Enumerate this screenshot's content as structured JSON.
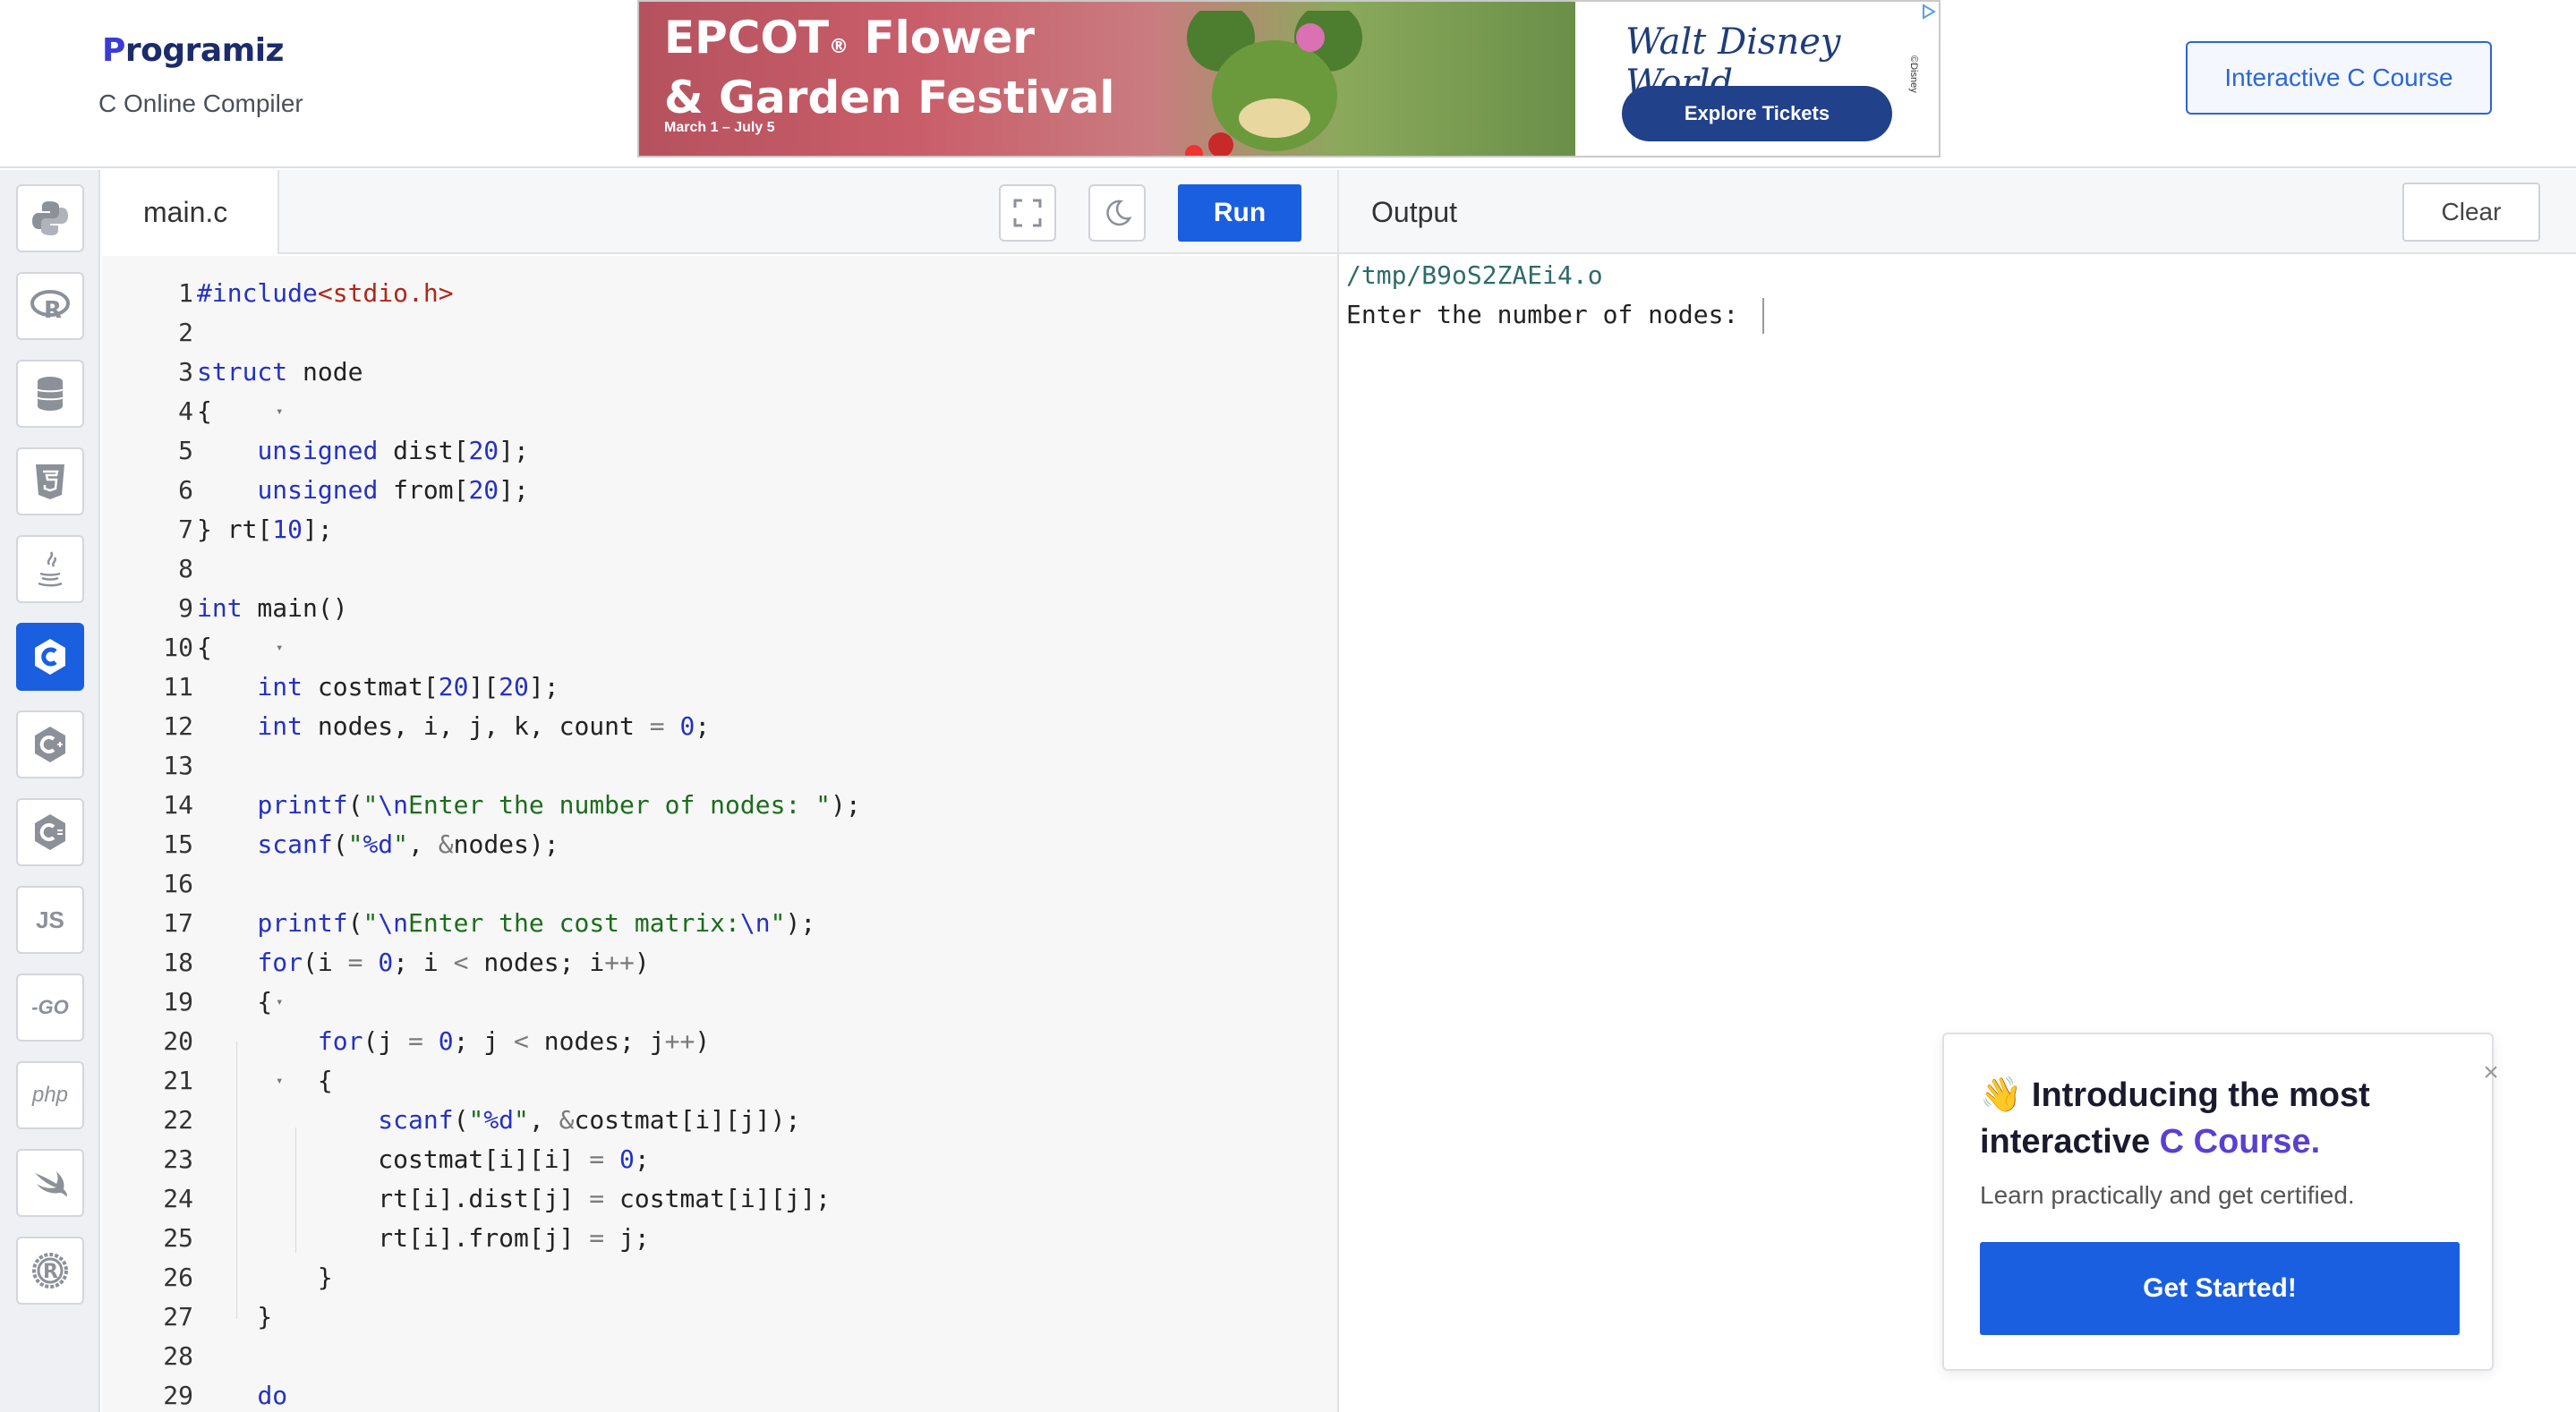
{
  "header": {
    "logo_text": "rogramiz",
    "logo_p": "P",
    "subtitle": "C Online Compiler",
    "course_button": "Interactive C Course"
  },
  "ad": {
    "title_line1": "EPCOT",
    "title_reg": "®",
    "title_line1b": " Flower",
    "title_line2": "& Garden Festival",
    "dates": "March 1 – July 5",
    "brand": "Walt Disney World.",
    "cta": "Explore Tickets",
    "copyright": "©Disney"
  },
  "sidebar": {
    "items": [
      {
        "name": "python",
        "label": ""
      },
      {
        "name": "r",
        "label": ""
      },
      {
        "name": "sql",
        "label": ""
      },
      {
        "name": "html",
        "label": ""
      },
      {
        "name": "java",
        "label": ""
      },
      {
        "name": "c",
        "label": "",
        "active": true
      },
      {
        "name": "cpp",
        "label": ""
      },
      {
        "name": "csharp",
        "label": ""
      },
      {
        "name": "javascript",
        "label": "JS"
      },
      {
        "name": "go",
        "label": "-GO"
      },
      {
        "name": "php",
        "label": "php"
      },
      {
        "name": "swift",
        "label": ""
      },
      {
        "name": "rust",
        "label": ""
      }
    ]
  },
  "editor": {
    "filename": "main.c",
    "run_label": "Run",
    "line_numbers": [
      "1",
      "2",
      "3",
      "4",
      "5",
      "6",
      "7",
      "8",
      "9",
      "10",
      "11",
      "12",
      "13",
      "14",
      "15",
      "16",
      "17",
      "18",
      "19",
      "20",
      "21",
      "22",
      "23",
      "24",
      "25",
      "26",
      "27",
      "28",
      "29"
    ]
  },
  "output": {
    "title": "Output",
    "clear_label": "Clear",
    "path": "/tmp/B9oS2ZAEi4.o",
    "prompt": "Enter the number of nodes: "
  },
  "popup": {
    "wave": "👋",
    "title_a": " Introducing the most interactive ",
    "title_hl": "C Course.",
    "subtitle": "Learn practically and get certified.",
    "cta": "Get Started!"
  },
  "colors": {
    "accent": "#1a5fe0",
    "keyword": "#2431c2",
    "string": "#1b6d1b",
    "include": "#b0281a"
  }
}
